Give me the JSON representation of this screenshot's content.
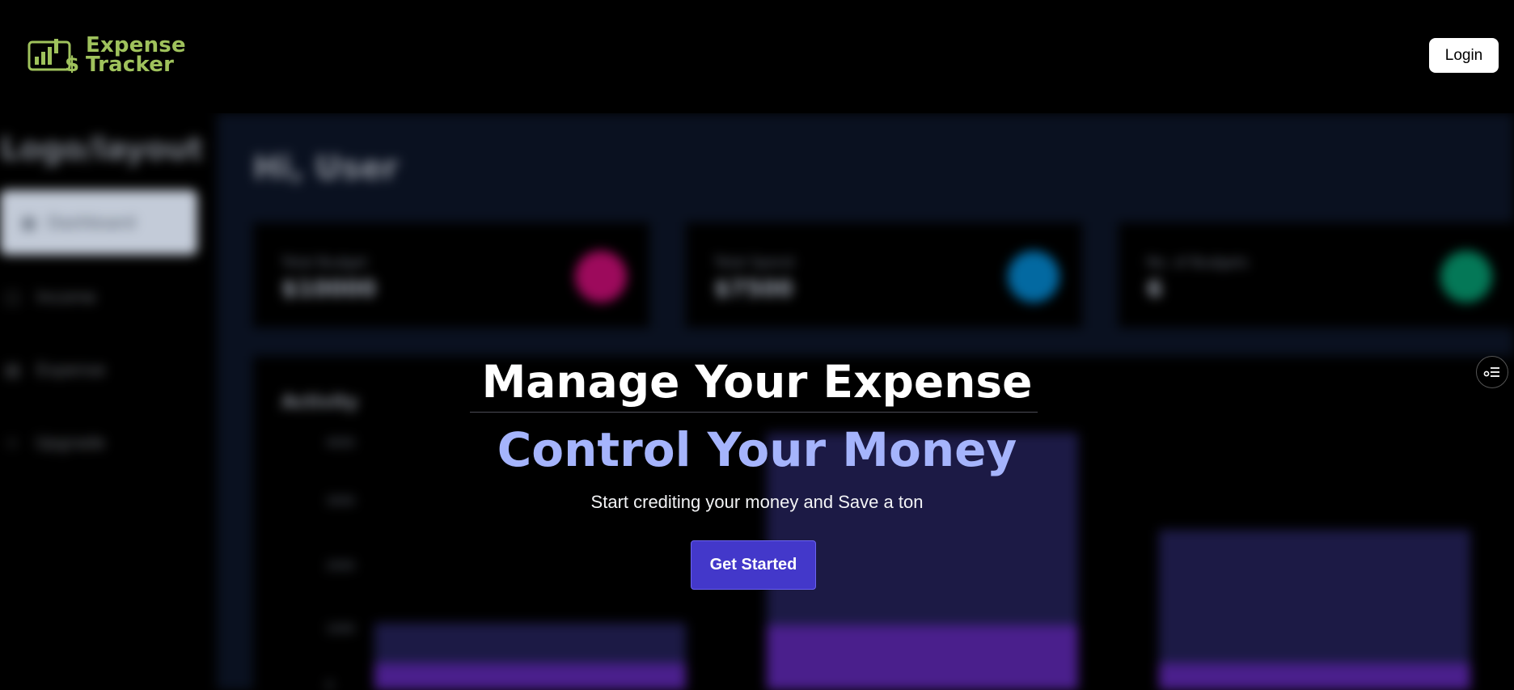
{
  "brand": {
    "line1": "Expense",
    "line2": "Tracker",
    "color": "#9fc25c"
  },
  "header": {
    "login_label": "Login"
  },
  "hero": {
    "title": "Manage Your Expense",
    "subtitle": "Control Your Money",
    "tagline": "Start crediting your money and Save a ton",
    "cta_label": "Get Started",
    "accent": "#a5b4fc",
    "cta_color": "#4338ca"
  },
  "floating_button": {
    "icon": "filter-list-icon"
  },
  "background_dashboard": {
    "sidebar": {
      "brand": "Logo/layout",
      "items": [
        {
          "label": "Dashboard",
          "icon": "grid-icon",
          "active": true
        },
        {
          "label": "Income",
          "icon": "wallet-icon"
        },
        {
          "label": "Expense",
          "icon": "receipt-icon"
        },
        {
          "label": "Upgrade",
          "icon": "star-icon"
        }
      ]
    },
    "greeting": "Hi, User",
    "cards": [
      {
        "label": "Total Budget",
        "value": "$10000",
        "color": "#9d0a5c"
      },
      {
        "label": "Total Spend",
        "value": "$7500",
        "color": "#0369a1"
      },
      {
        "label": "No. of Budgets",
        "value": "6",
        "color": "#047857"
      }
    ],
    "activity": {
      "title": "Activity",
      "y_ticks": [
        "4000",
        "3000",
        "2000",
        "1000",
        "0"
      ]
    }
  }
}
